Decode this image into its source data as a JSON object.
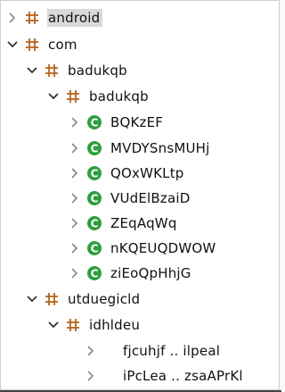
{
  "tree": {
    "items": [
      {
        "label": "android",
        "icon": "package-icon",
        "expanded": false,
        "selected": true
      },
      {
        "label": "com",
        "icon": "package-icon",
        "expanded": true
      },
      {
        "label": "badukqb",
        "icon": "package-icon",
        "expanded": true
      },
      {
        "label": "badukqb",
        "icon": "package-icon",
        "expanded": true
      },
      {
        "label": "BQKzEF",
        "icon": "class-icon",
        "expanded": false
      },
      {
        "label": "MVDYSnsMUHj",
        "icon": "class-icon",
        "expanded": false
      },
      {
        "label": "QOxWKLtp",
        "icon": "class-icon",
        "expanded": false
      },
      {
        "label": "VUdElBzaiD",
        "icon": "class-icon",
        "expanded": false
      },
      {
        "label": "ZEqAqWq",
        "icon": "class-icon",
        "expanded": false
      },
      {
        "label": "nKQEUQDWOW",
        "icon": "class-icon",
        "expanded": false
      },
      {
        "label": "ziEoQpHhjG",
        "icon": "class-icon",
        "expanded": false
      },
      {
        "label": "utduegicld",
        "icon": "package-icon",
        "expanded": true
      },
      {
        "label": "idhldeu",
        "icon": "package-icon",
        "expanded": true
      },
      {
        "label": "fjcuhjf .. ilpeal",
        "icon": "",
        "expanded": false
      },
      {
        "label": "iPcLea .. zsaAPrKl",
        "icon": "",
        "expanded": false
      }
    ]
  },
  "colors": {
    "package_icon": "#b5651d",
    "class_icon": "#2e9e3e",
    "selection": "#d9d9d9"
  }
}
